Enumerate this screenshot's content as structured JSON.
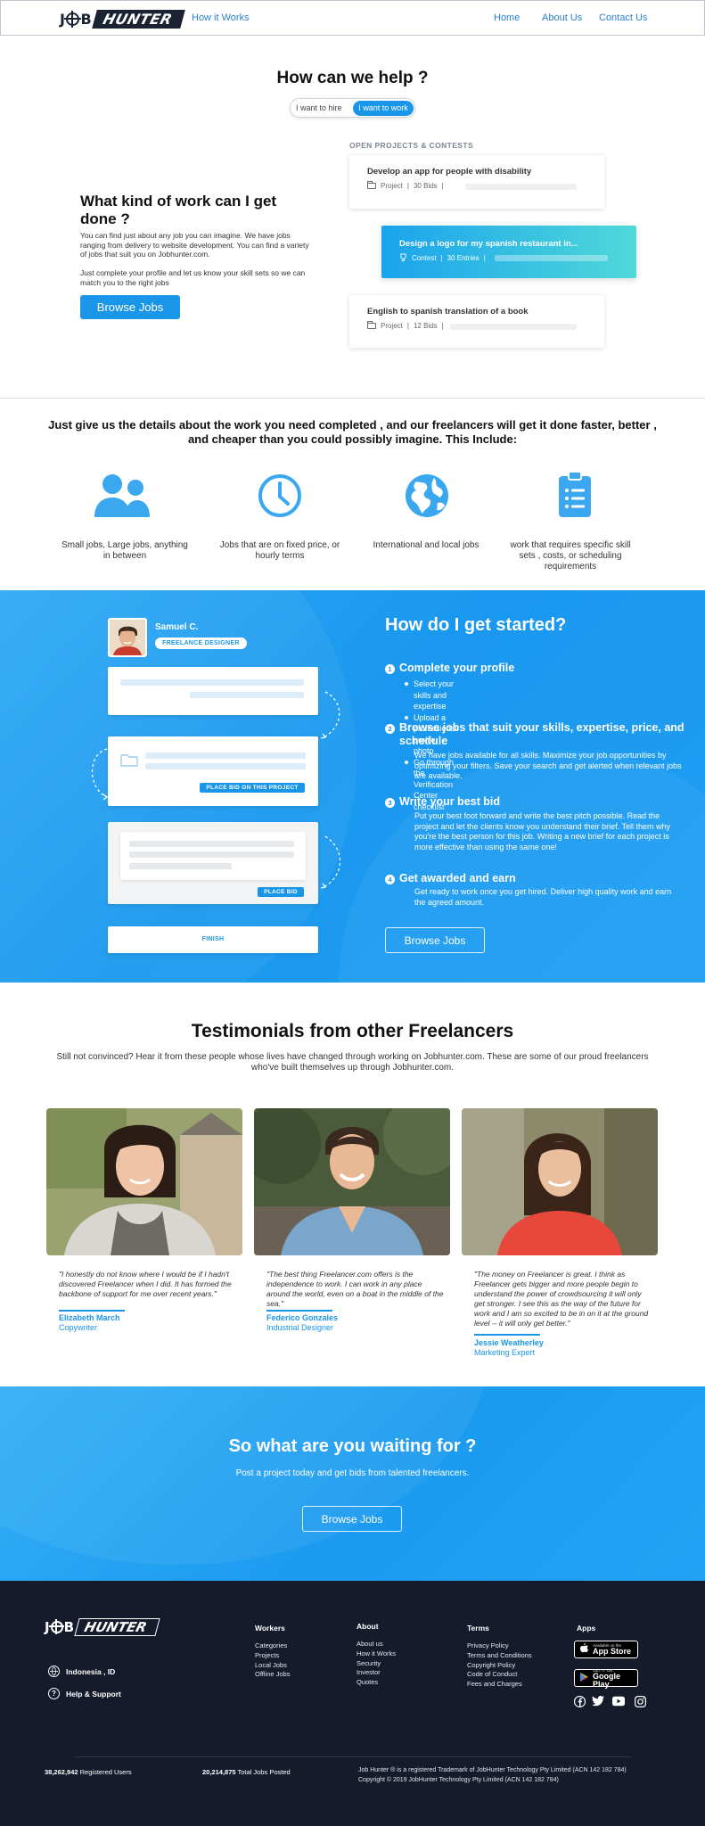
{
  "nav": {
    "logo_job": "J",
    "logo_b": "B",
    "logo_hunter": "HUNTER",
    "how_it_works": "How it Works",
    "home": "Home",
    "about": "About Us",
    "contact": "Contact Us"
  },
  "help": {
    "title": "How can we help ?",
    "toggle_hire": "I want to hire",
    "toggle_work": "I want to work",
    "heading": "What kind of work can I get done ?",
    "para1": "You can find just about any job you can imagine. We have jobs ranging from delivery to website development. You can find a variety of jobs that suit you on Jobhunter.com.",
    "para2": "Just complete your profile and let us know your skill sets so we can match you to the right jobs",
    "browse_btn": "Browse Jobs",
    "open_label": "OPEN PROJECTS & CONTESTS",
    "projects": [
      {
        "title": "Develop an app for people with disability",
        "type": "Project",
        "count": "30 Bids"
      },
      {
        "title": "Design a logo for my spanish restaurant in...",
        "type": "Contest",
        "count": "30 Entries"
      },
      {
        "title": "English to spanish translation of a book",
        "type": "Project",
        "count": "12 Bids"
      }
    ]
  },
  "features": {
    "title": "Just give us the details about the work you need completed , and our freelancers will get it done faster, better , and cheaper than you could possibly imagine. This Include:",
    "items": [
      {
        "icon": "people-icon",
        "text": "Small jobs, Large jobs, anything in between"
      },
      {
        "icon": "clock-icon",
        "text": "Jobs that are on fixed price, or hourly terms"
      },
      {
        "icon": "globe-icon",
        "text": "International and local jobs"
      },
      {
        "icon": "clipboard-icon",
        "text": "work that requires specific skill sets , costs, or scheduling requirements"
      }
    ]
  },
  "started": {
    "user_name": "Samuel C.",
    "user_badge": "FREELANCE DESIGNER",
    "place_bid_project": "PLACE BID ON THIS PROJECT",
    "place_bid": "PLACE BID",
    "finish": "FINISH",
    "title": "How do I get started?",
    "steps": [
      {
        "num": "1",
        "heading": "Complete your profile",
        "bullets": [
          "Select your skills and expertise",
          "Upload a professional profile photo",
          "Go through the Verification Center checklist"
        ]
      },
      {
        "num": "2",
        "heading": "Browse jobs that suit your skills, expertise, price, and schedule",
        "text": "We have jobs available for all skills. Maximize your job opportunities by optimizing your filters. Save your search and get alerted when relevant jobs are available."
      },
      {
        "num": "3",
        "heading": "Write your best bid",
        "text": "Put your best foot forward and write the best pitch possible. Read the project and let the clients know you understand their brief. Tell them why you're the best person for this job. Writing a new brief for each project is more effective than using the same one!"
      },
      {
        "num": "4",
        "heading": "Get awarded and earn",
        "text": "Get ready to work once you get hired. Deliver high quality work and earn the agreed amount."
      }
    ],
    "browse_btn": "Browse Jobs"
  },
  "testimonials": {
    "title": "Testimonials from other Freelancers",
    "subtitle": "Still not convinced? Hear it from these people whose lives have changed through working on Jobhunter.com. These are some of our proud freelancers who've built themselves up through Jobhunter.com.",
    "items": [
      {
        "quote": "\"I honestly do not know where I would be if I hadn't discovered Freelancer when I did. It has formed the backbone of support for me over recent years.\"",
        "name": "Elizabeth March",
        "role": "Copywriter"
      },
      {
        "quote": "\"The best thing Freelancer.com offers is the independence to work. I can work in any place around the world, even on a boat in the middle of the sea.\"",
        "name": "Federico Gonzales",
        "role": "Industrial Designer"
      },
      {
        "quote": "\"The money on Freelancer is great. I think as Freelancer gets bigger and more people begin to understand the power of crowdsourcing it will only get stronger. I see this as the way of the future for work and I am so excited to be in on it at the ground level -- it will only get better.\"",
        "name": "Jessie Weatherley",
        "role": "Marketing Expert"
      }
    ]
  },
  "cta": {
    "title": "So what are you waiting for ?",
    "subtitle": "Post a project today and get bids from talented freelancers.",
    "button": "Browse Jobs"
  },
  "footer": {
    "logo_job": "J",
    "logo_b": "B",
    "logo_hunter": "HUNTER",
    "location": "Indonesia , ID",
    "help": "Help & Support",
    "workers": {
      "heading": "Workers",
      "links": [
        "Categories",
        "Projects",
        "Local Jobs",
        "Offline Jobs"
      ]
    },
    "about": {
      "heading": "About",
      "links": [
        "About us",
        "How it Works",
        "Security",
        "Investor",
        "Quotes"
      ]
    },
    "terms": {
      "heading": "Terms",
      "links": [
        "Privacy Policy",
        "Terms and Conditions",
        "Copyright Policy",
        "Code of Conduct",
        "Fees and Charges"
      ]
    },
    "apps": {
      "heading": "Apps",
      "app_store_small": "Available on the",
      "app_store": "App Store",
      "google_small": "GET IT ON",
      "google": "Google Play"
    },
    "users_count": "38,262,942",
    "users_label": "Registered Users",
    "jobs_count": "20,214,875",
    "jobs_label": "Total Jobs Posted",
    "trademark": "Job Hunter ® is a registered Trademark of JobHunter Technology Pty Limited (ACN 142 182 784)",
    "copyright": "Copyright © 2019 JobHunter Technology Pty Limited (ACN 142 182 784)"
  },
  "colors": {
    "accent": "#1a96e8",
    "footer": "#161b2c",
    "dark": "#1b2333"
  }
}
